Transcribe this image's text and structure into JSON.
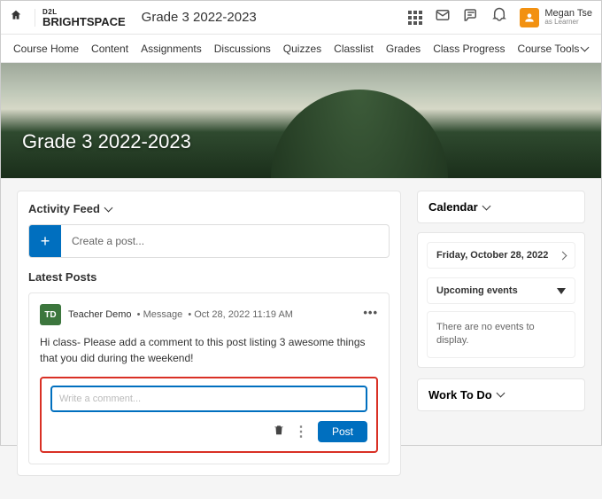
{
  "header": {
    "logo_top": "D2L",
    "logo_bottom": "BRIGHTSPACE",
    "course_title": "Grade 3 2022-2023",
    "user_name": "Megan Tse",
    "user_role": "as Learner"
  },
  "nav": {
    "items": [
      "Course Home",
      "Content",
      "Assignments",
      "Discussions",
      "Quizzes",
      "Classlist",
      "Grades",
      "Class Progress",
      "Course Tools"
    ]
  },
  "banner": {
    "title": "Grade 3 2022-2023"
  },
  "feed": {
    "header": "Activity Feed",
    "create_placeholder": "Create a post...",
    "latest_label": "Latest Posts",
    "post": {
      "avatar_initials": "TD",
      "author": "Teacher Demo",
      "type": "Message",
      "timestamp": "Oct 28, 2022 11:19 AM",
      "body": "Hi class- Please add a comment to this post listing 3 awesome things that you did during the weekend!",
      "comment_placeholder": "Write a comment...",
      "post_button": "Post"
    }
  },
  "calendar": {
    "header": "Calendar",
    "date": "Friday, October 28, 2022",
    "upcoming_label": "Upcoming events",
    "no_events": "There are no events to display."
  },
  "work": {
    "header": "Work To Do"
  }
}
